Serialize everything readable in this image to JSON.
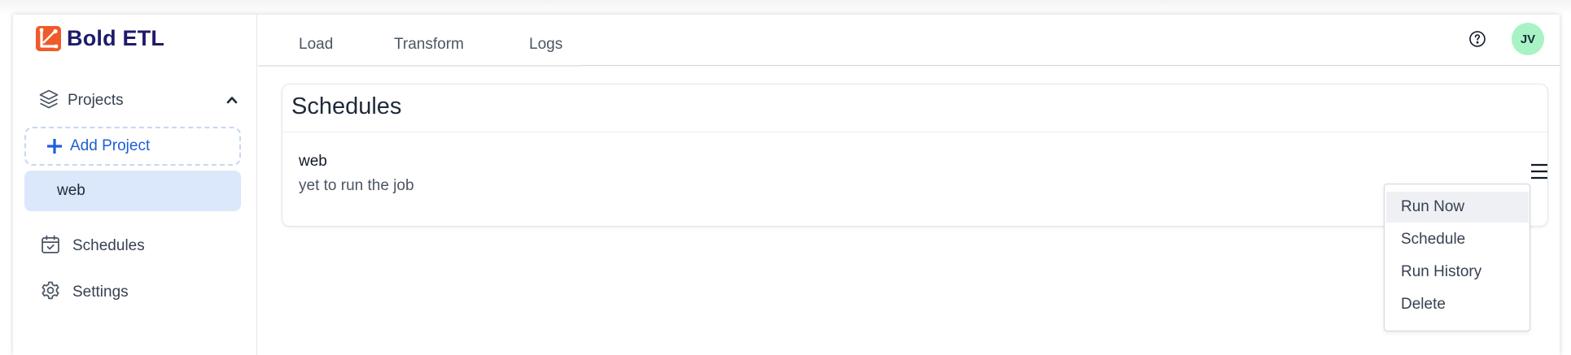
{
  "brand": {
    "name": "Bold ETL",
    "logo_icon": "bold-etl-logo",
    "logo_color": "#f05a28",
    "name_color": "#1e1b6b"
  },
  "sidebar": {
    "projects_label": "Projects",
    "projects_icon": "layers-icon",
    "projects_expanded": true,
    "add_project_label": "Add Project",
    "projects": [
      {
        "label": "web",
        "selected": true
      }
    ],
    "items": [
      {
        "label": "Schedules",
        "icon": "calendar-check-icon"
      },
      {
        "label": "Settings",
        "icon": "gear-icon"
      }
    ]
  },
  "header": {
    "tabs": [
      {
        "label": "Load"
      },
      {
        "label": "Transform"
      },
      {
        "label": "Logs"
      }
    ],
    "help_icon": "question-circle-icon",
    "avatar_initials": "JV",
    "avatar_color": "#a7f3c4"
  },
  "schedules": {
    "title": "Schedules",
    "rows": [
      {
        "name": "web",
        "status": "yet to run the job",
        "menu_icon": "hamburger-menu-icon"
      }
    ]
  },
  "row_menu": {
    "items": [
      {
        "label": "Run Now",
        "hovered": true
      },
      {
        "label": "Schedule"
      },
      {
        "label": "Run History"
      },
      {
        "label": "Delete"
      }
    ]
  },
  "colors": {
    "accent": "#1d5fd6",
    "selected_bg": "#dbe8fb"
  }
}
